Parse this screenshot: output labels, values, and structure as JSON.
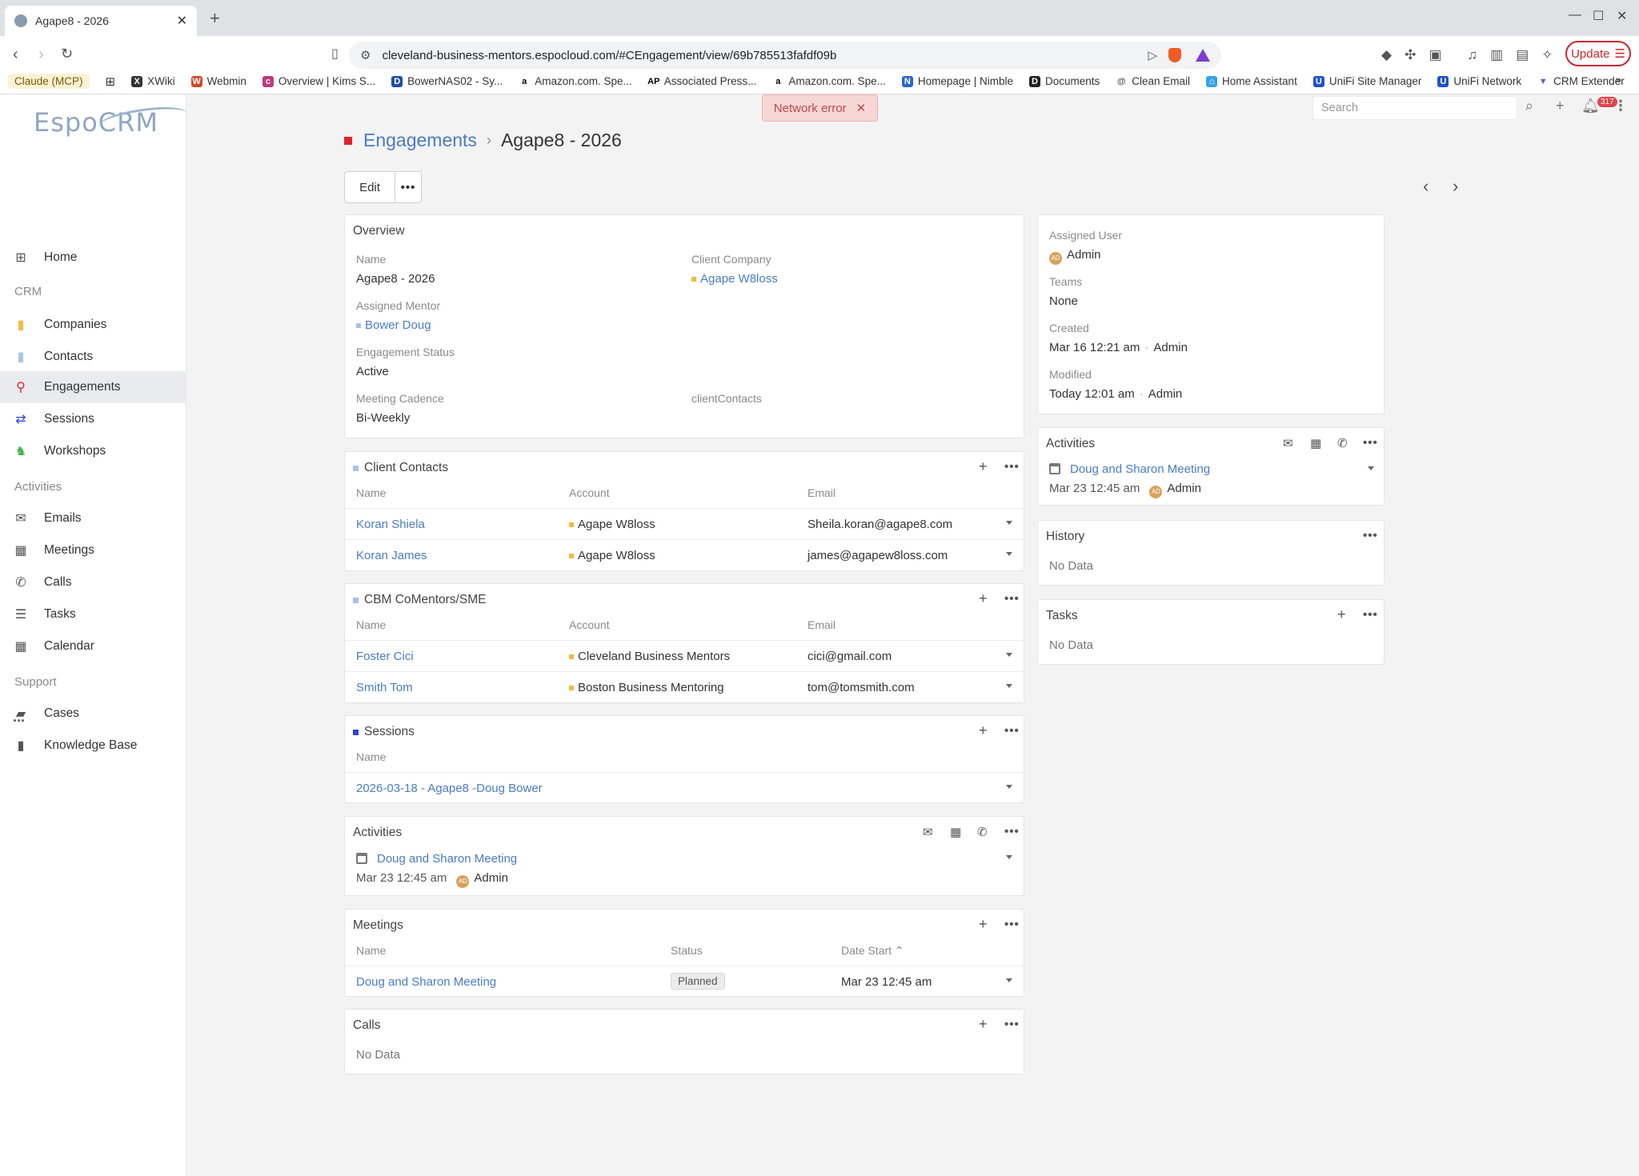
{
  "browser": {
    "tab_title": "Agape8 - 2026",
    "url": "cleveland-business-mentors.espocloud.com/#CEngagement/view/69b785513fafdf09b",
    "update_label": "Update",
    "bookmarks": [
      "Claude (MCP)",
      "XWiki",
      "Webmin",
      "Overview | Kims S...",
      "BowerNAS02 - Sy...",
      "Amazon.com. Spe...",
      "Associated Press...",
      "Amazon.com. Spe...",
      "Homepage | Nimble",
      "Documents",
      "Clean Email",
      "Home Assistant",
      "UniFi Site Manager",
      "UniFi Network",
      "CRM Extender"
    ]
  },
  "app": {
    "logo": "EspoCRM",
    "search_placeholder": "Search",
    "notification_count": "317",
    "toast": "Network error"
  },
  "sidebar": {
    "home": "Home",
    "crm_header": "CRM",
    "companies": "Companies",
    "contacts": "Contacts",
    "engagements": "Engagements",
    "sessions": "Sessions",
    "workshops": "Workshops",
    "activities_header": "Activities",
    "emails": "Emails",
    "meetings": "Meetings",
    "calls": "Calls",
    "tasks": "Tasks",
    "calendar": "Calendar",
    "support_header": "Support",
    "cases": "Cases",
    "knowledge_base": "Knowledge Base",
    "more": "..."
  },
  "header": {
    "breadcrumb_parent": "Engagements",
    "breadcrumb_current": "Agape8 - 2026",
    "edit_label": "Edit",
    "more_label": "•••"
  },
  "overview": {
    "title": "Overview",
    "name_label": "Name",
    "name": "Agape8 - 2026",
    "client_company_label": "Client Company",
    "client_company": "Agape W8loss",
    "mentor_label": "Assigned Mentor",
    "mentor": "Bower Doug",
    "status_label": "Engagement Status",
    "status": "Active",
    "cadence_label": "Meeting Cadence",
    "cadence": "Bi-Weekly",
    "client_contacts_label": "clientContacts"
  },
  "client_contacts": {
    "title": "Client Contacts",
    "columns": [
      "Name",
      "Account",
      "Email"
    ],
    "rows": [
      {
        "name": "Koran Shiela",
        "account": "Agape W8loss",
        "email": "Sheila.koran@agape8.com"
      },
      {
        "name": "Koran James",
        "account": "Agape W8loss",
        "email": "james@agapew8loss.com"
      }
    ]
  },
  "comentors": {
    "title": "CBM CoMentors/SME",
    "columns": [
      "Name",
      "Account",
      "Email"
    ],
    "rows": [
      {
        "name": "Foster Cici",
        "account": "Cleveland Business Mentors",
        "email": "cici@gmail.com"
      },
      {
        "name": "Smith Tom",
        "account": "Boston Business Mentoring",
        "email": "tom@tomsmith.com"
      }
    ]
  },
  "sessions": {
    "title": "Sessions",
    "column": "Name",
    "rows": [
      {
        "name": "2026-03-18 - Agape8 -Doug Bower"
      }
    ]
  },
  "activities_main": {
    "title": "Activities",
    "item_title": "Doug and Sharon Meeting",
    "item_date": "Mar 23 12:45 am",
    "item_user": "Admin",
    "avatar": "AD"
  },
  "meetings": {
    "title": "Meetings",
    "columns": [
      "Name",
      "Status",
      "Date Start"
    ],
    "rows": [
      {
        "name": "Doug and Sharon Meeting",
        "status": "Planned",
        "date": "Mar 23 12:45 am"
      }
    ]
  },
  "calls": {
    "title": "Calls",
    "no_data": "No Data"
  },
  "side": {
    "assigned_user_label": "Assigned User",
    "assigned_user": "Admin",
    "teams_label": "Teams",
    "teams": "None",
    "created_label": "Created",
    "created_date": "Mar 16 12:21 am",
    "created_by": "Admin",
    "modified_label": "Modified",
    "modified_date": "Today 12:01 am",
    "modified_by": "Admin",
    "avatar": "AD"
  },
  "side_activities": {
    "title": "Activities",
    "item_title": "Doug and Sharon Meeting",
    "item_date": "Mar 23 12:45 am",
    "item_user": "Admin"
  },
  "history": {
    "title": "History",
    "no_data": "No Data"
  },
  "tasks": {
    "title": "Tasks",
    "no_data": "No Data"
  }
}
